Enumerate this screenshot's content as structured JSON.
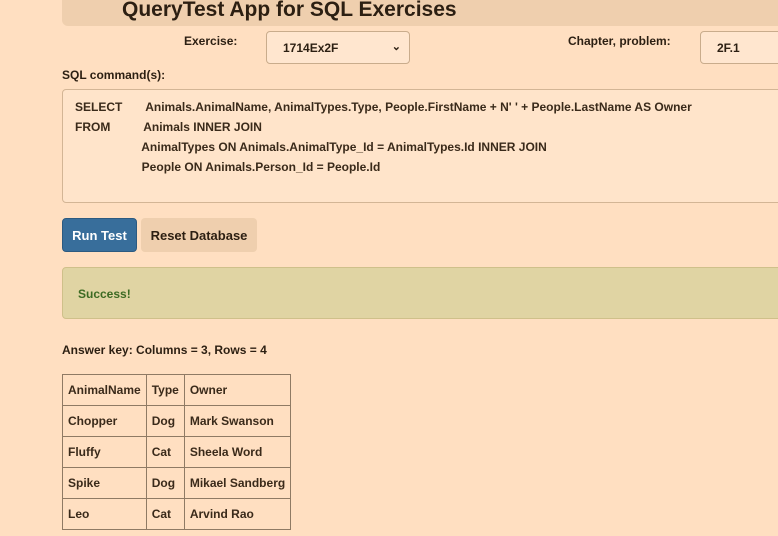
{
  "header": {
    "title": "QueryTest App for SQL Exercises"
  },
  "exercise": {
    "label": "Exercise:",
    "selected": "1714Ex2F"
  },
  "chapter": {
    "label": "Chapter, problem:",
    "value": "2F.1"
  },
  "sql": {
    "label": "SQL command(s):",
    "lines": [
      "SELECT       Animals.AnimalName, AnimalTypes.Type, People.FirstName + N' ' + People.LastName AS Owner",
      "FROM          Animals INNER JOIN",
      "                    AnimalTypes ON Animals.AnimalType_Id = AnimalTypes.Id INNER JOIN",
      "                    People ON Animals.Person_Id = People.Id"
    ]
  },
  "buttons": {
    "run": "Run Test",
    "reset": "Reset Database"
  },
  "status": {
    "message": "Success!"
  },
  "answer_key": {
    "summary": "Answer key: Columns = 3, Rows = 4",
    "columns": [
      "AnimalName",
      "Type",
      "Owner"
    ],
    "rows": [
      [
        "Chopper",
        "Dog",
        "Mark Swanson"
      ],
      [
        "Fluffy",
        "Cat",
        "Sheela Word"
      ],
      [
        "Spike",
        "Dog",
        "Mikael Sandberg"
      ],
      [
        "Leo",
        "Cat",
        "Arvind Rao"
      ]
    ]
  },
  "icons": {
    "select_chevron": "chevron-down-icon"
  }
}
